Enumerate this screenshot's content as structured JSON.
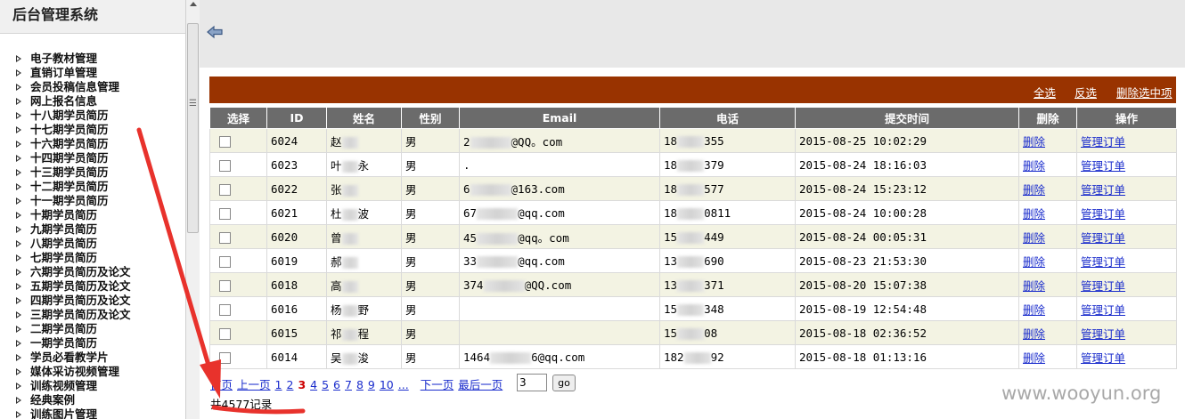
{
  "sidebar": {
    "title": "后台管理系统",
    "items": [
      "电子教材管理",
      "直销订单管理",
      "会员投稿信息管理",
      "网上报名信息",
      "十八期学员简历",
      "十七期学员简历",
      "十六期学员简历",
      "十四期学员简历",
      "十三期学员简历",
      "十二期学员简历",
      "十一期学员简历",
      "十期学员简历",
      "九期学员简历",
      "八期学员简历",
      "七期学员简历",
      "六期学员简历及论文",
      "五期学员简历及论文",
      "四期学员简历及论文",
      "三期学员简历及论文",
      "二期学员简历",
      "一期学员简历",
      "学员必看教学片",
      "媒体采访视频管理",
      "训练视频管理",
      "经典案例",
      "训练图片管理"
    ]
  },
  "toolbar": {
    "select_all": "全选",
    "invert": "反选",
    "delete_selected": "删除选中项"
  },
  "table": {
    "columns": [
      "选择",
      "ID",
      "姓名",
      "性别",
      "Email",
      "电话",
      "提交时间",
      "删除",
      "操作"
    ],
    "delete_label": "删除",
    "manage_label": "管理订单",
    "rows": [
      {
        "id": "6024",
        "name_a": "赵",
        "name_b": "",
        "gender": "男",
        "email_a": "2",
        "email_b": "@QQ。com",
        "phone_a": "18",
        "phone_b": "355",
        "time": "2015-08-25 10:02:29"
      },
      {
        "id": "6023",
        "name_a": "叶",
        "name_b": "永",
        "gender": "男",
        "email_a": ".",
        "email_b": "",
        "phone_a": "18",
        "phone_b": "379",
        "time": "2015-08-24 18:16:03"
      },
      {
        "id": "6022",
        "name_a": "张",
        "name_b": "",
        "gender": "男",
        "email_a": "6",
        "email_b": "@163.com",
        "phone_a": "18",
        "phone_b": "577",
        "time": "2015-08-24 15:23:12"
      },
      {
        "id": "6021",
        "name_a": "杜",
        "name_b": "波",
        "gender": "男",
        "email_a": "67",
        "email_b": "@qq.com",
        "phone_a": "18",
        "phone_b": "0811",
        "time": "2015-08-24 10:00:28"
      },
      {
        "id": "6020",
        "name_a": "曾",
        "name_b": "",
        "gender": "男",
        "email_a": "45",
        "email_b": "@qq。com",
        "phone_a": "15",
        "phone_b": "449",
        "time": "2015-08-24 00:05:31"
      },
      {
        "id": "6019",
        "name_a": "郝",
        "name_b": "",
        "gender": "男",
        "email_a": "33",
        "email_b": "@qq.com",
        "phone_a": "13",
        "phone_b": "690",
        "time": "2015-08-23 21:53:30"
      },
      {
        "id": "6018",
        "name_a": "高",
        "name_b": "",
        "gender": "男",
        "email_a": "374",
        "email_b": "@QQ.com",
        "phone_a": "13",
        "phone_b": "371",
        "time": "2015-08-20 15:07:38"
      },
      {
        "id": "6016",
        "name_a": "杨",
        "name_b": "野",
        "gender": "男",
        "email_a": "",
        "email_b": "",
        "phone_a": "15",
        "phone_b": "348",
        "time": "2015-08-19 12:54:48"
      },
      {
        "id": "6015",
        "name_a": "祁",
        "name_b": "程",
        "gender": "男",
        "email_a": "",
        "email_b": "",
        "phone_a": "15",
        "phone_b": "08",
        "time": "2015-08-18 02:36:52"
      },
      {
        "id": "6014",
        "name_a": "吴",
        "name_b": "浚",
        "gender": "男",
        "email_a": "1464",
        "email_b": "6@qq.com",
        "phone_a": "182",
        "phone_b": "92",
        "time": "2015-08-18 01:13:16"
      }
    ]
  },
  "pager": {
    "first": "首页",
    "prev": "上一页",
    "pages": [
      "1",
      "2",
      "3",
      "4",
      "5",
      "6",
      "7",
      "8",
      "9",
      "10",
      "..."
    ],
    "current": "3",
    "next": "下一页",
    "last": "最后一页",
    "input_value": "3",
    "go": "go",
    "total": "共4577记录"
  },
  "watermark": "www.wooyun.org",
  "colors": {
    "toolbar_bg": "#993300",
    "header_bg": "#6b6b6b",
    "odd_row": "#f3f3e3",
    "link": "#1a2ccc",
    "annotation": "#e8322c"
  }
}
